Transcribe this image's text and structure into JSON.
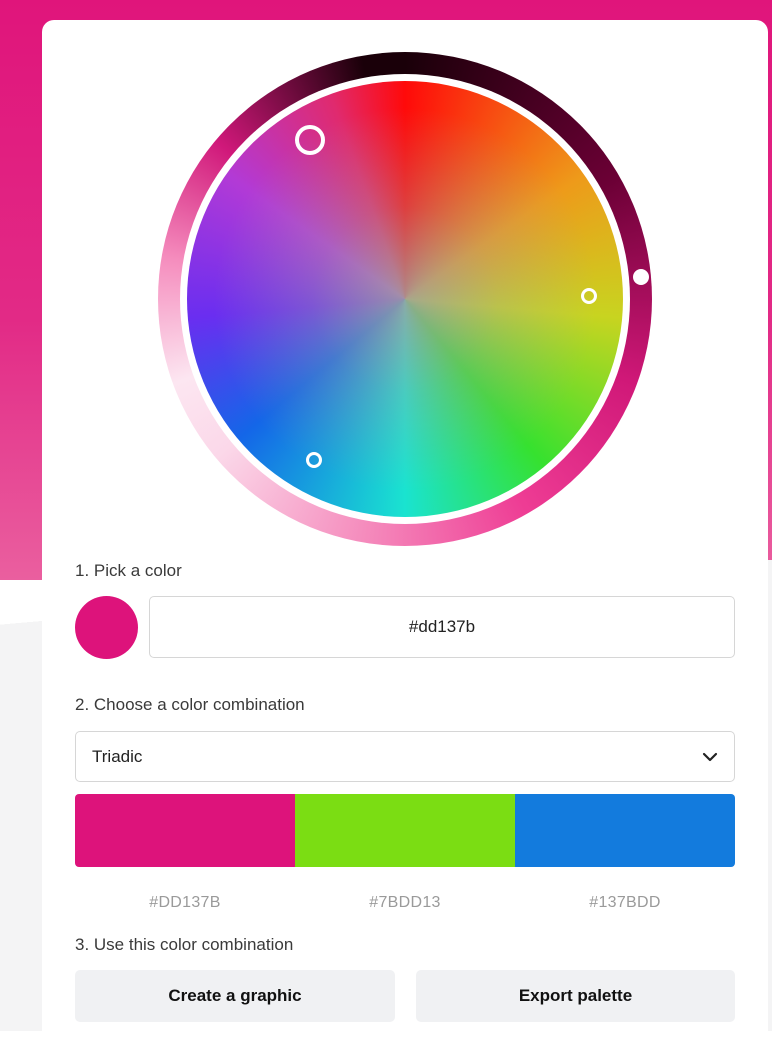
{
  "steps": {
    "pick": "1. Pick a color",
    "combo": "2. Choose a color combination",
    "use": "3. Use this color combination"
  },
  "picker": {
    "hex_value": "#dd137b",
    "selected_color": "#dd137b"
  },
  "combination": {
    "selected": "Triadic"
  },
  "palette": {
    "swatches": [
      {
        "color": "#dd137b",
        "label": "#DD137B"
      },
      {
        "color": "#7bdd13",
        "label": "#7BDD13"
      },
      {
        "color": "#137bdd",
        "label": "#137BDD"
      }
    ]
  },
  "actions": {
    "create": "Create a graphic",
    "export": "Export palette"
  },
  "colors": {
    "brand": "#e0157b",
    "button_bg": "#f0f1f3",
    "hex_label": "#9a9a9a"
  },
  "icons": {
    "dropdown": "chevron-down-icon"
  }
}
